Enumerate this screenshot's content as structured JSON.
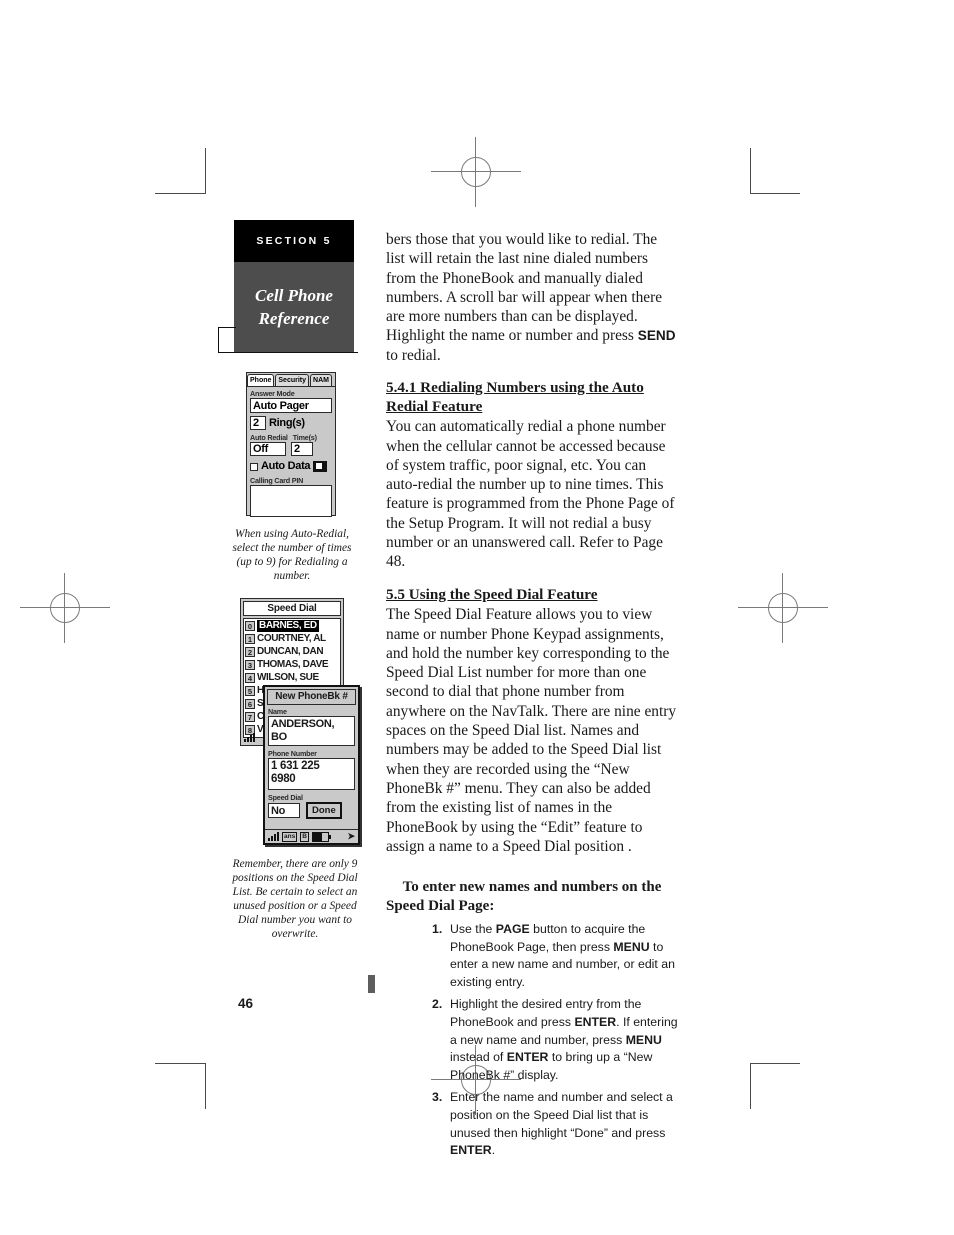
{
  "page": {
    "number": "46",
    "section_tab": "SECTION 5",
    "section_title_line1": "Cell Phone",
    "section_title_line2": "Reference"
  },
  "main": {
    "intro_paragraph": "bers those that you would like to redial. The list will retain the last nine dialed numbers from the PhoneBook and manually dialed numbers.  A scroll bar will appear when there are more numbers than can be displayed. Highlight the name or number and press ",
    "intro_bold": "SEND",
    "intro_tail": " to redial.",
    "heading_541": "5.4.1 Redialing Numbers using the Auto Redial Feature",
    "paragraph_541": "You can automatically redial a phone number when the cellular cannot be accessed because of system traffic, poor signal, etc. You can auto-redial the number up to nine times. This feature is programmed from the Phone Page of the Setup Program. It will not redial a busy number or an unanswered call. Refer to Page 48.",
    "heading_55": "5.5  Using the Speed Dial Feature",
    "paragraph_55": "    The Speed Dial Feature allows you to view name or number Phone Keypad assignments, and hold the number key corresponding to the Speed Dial List number for more than one second to dial that phone number from anywhere on the NavTalk. There are nine entry spaces on the Speed Dial list. Names and numbers may be added to the Speed Dial list when they are recorded using the “New PhoneBk #” menu. They can also be added from the existing list of names in the PhoneBook by using the “Edit” feature to assign a name to a Speed Dial position .",
    "procedure_heading_line1": "To enter new names and numbers on the",
    "procedure_heading_line2": "Speed Dial Page:",
    "steps": [
      {
        "num": "1.",
        "parts": [
          {
            "text": "Use the ",
            "bold": false
          },
          {
            "text": "PAGE",
            "bold": true
          },
          {
            "text": " button to acquire the PhoneBook Page, then press ",
            "bold": false
          },
          {
            "text": "MENU",
            "bold": true
          },
          {
            "text": " to enter a new name and number, or edit an existing entry.",
            "bold": false
          }
        ]
      },
      {
        "num": "2.",
        "parts": [
          {
            "text": "Highlight the desired entry from the PhoneBook and press ",
            "bold": false
          },
          {
            "text": "ENTER",
            "bold": true
          },
          {
            "text": ". If entering a new name and number, press ",
            "bold": false
          },
          {
            "text": "MENU",
            "bold": true
          },
          {
            "text": " instead of ",
            "bold": false
          },
          {
            "text": "ENTER",
            "bold": true
          },
          {
            "text": " to bring up a “New PhoneBk #” display.",
            "bold": false
          }
        ]
      },
      {
        "num": "3.",
        "parts": [
          {
            "text": "Enter the name and number and select a position on the Speed Dial list that is unused then highlight “Done” and press ",
            "bold": false
          },
          {
            "text": "ENTER",
            "bold": true
          },
          {
            "text": ".",
            "bold": false
          }
        ]
      }
    ]
  },
  "figures": {
    "phone_setup": {
      "tabs": [
        "Phone",
        "Security",
        "NAM"
      ],
      "answer_mode_label": "Answer Mode",
      "answer_mode_value": "Auto Pager",
      "rings_value": "2",
      "rings_label": "Ring(s)",
      "auto_redial_label": "Auto Redial",
      "auto_redial_value": "Off",
      "times_label": "Time(s)",
      "times_value": "2",
      "auto_data_label": "Auto Data",
      "calling_card_label": "Calling Card PIN",
      "calling_card_value": ""
    },
    "phone_setup_caption": "When using Auto-Redial, select the number of times (up to 9) for Redialing a number.",
    "speed_dial": {
      "title": "Speed Dial",
      "entries": [
        {
          "index": "0",
          "name": "BARNES, ED",
          "selected": true
        },
        {
          "index": "1",
          "name": "COURTNEY, AL",
          "selected": false
        },
        {
          "index": "2",
          "name": "DUNCAN, DAN",
          "selected": false
        },
        {
          "index": "3",
          "name": "THOMAS, DAVE",
          "selected": false
        },
        {
          "index": "4",
          "name": "WILSON, SUE",
          "selected": false
        },
        {
          "index": "5",
          "name": "HOME",
          "selected": false
        },
        {
          "index": "6",
          "name": "S",
          "selected": false
        },
        {
          "index": "7",
          "name": "C",
          "selected": false
        },
        {
          "index": "8",
          "name": "V",
          "selected": false
        }
      ]
    },
    "new_phonebk": {
      "title": "New PhoneBk #",
      "name_label": "Name",
      "name_value": "ANDERSON, BO",
      "phone_label": "Phone Number",
      "phone_value_line1": "1 631 225",
      "phone_value_line2": "6980",
      "speed_dial_label": "Speed Dial",
      "speed_dial_value": "No",
      "done_button": "Done",
      "status_ans": "ans",
      "status_band": "B"
    },
    "speed_dial_caption": "Remember, there are only 9 positions on the Speed Dial List. Be certain to select an unused position or a Speed Dial number you want to overwrite."
  }
}
